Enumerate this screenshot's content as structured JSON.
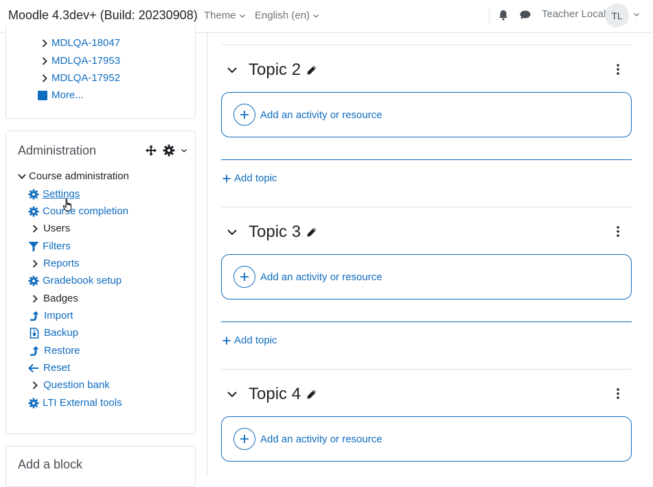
{
  "header": {
    "brand": "Moodle 4.3dev+ (Build: 20230908)",
    "theme_menu": "Theme",
    "language_menu": "English (en)",
    "user_name": "Teacher Local",
    "avatar_initials": "TL"
  },
  "sidebar": {
    "top_links": [
      "MDLQA-18047",
      "MDLQA-17953",
      "MDLQA-17952"
    ],
    "more_label": "More...",
    "admin_block": {
      "title": "Administration",
      "course_admin_label": "Course administration",
      "items": [
        {
          "label": "Settings",
          "icon": "gear-icon",
          "link": true
        },
        {
          "label": "Course completion",
          "icon": "gear-icon",
          "link": true
        },
        {
          "label": "Users",
          "icon": "chevron-right-icon",
          "link": false
        },
        {
          "label": "Filters",
          "icon": "filter-icon",
          "link": true
        },
        {
          "label": "Reports",
          "icon": "chevron-right-icon",
          "link": false
        },
        {
          "label": "Gradebook setup",
          "icon": "gear-icon",
          "link": true
        },
        {
          "label": "Badges",
          "icon": "chevron-right-icon",
          "link": false
        },
        {
          "label": "Import",
          "icon": "import-icon",
          "link": true
        },
        {
          "label": "Backup",
          "icon": "backup-icon",
          "link": true
        },
        {
          "label": "Restore",
          "icon": "restore-icon",
          "link": true
        },
        {
          "label": "Reset",
          "icon": "arrow-left-icon",
          "link": true
        },
        {
          "label": "Question bank",
          "icon": "chevron-right-icon",
          "link": true
        },
        {
          "label": "LTI External tools",
          "icon": "gear-icon",
          "link": true
        }
      ]
    },
    "add_block_title": "Add a block"
  },
  "main": {
    "topics": [
      {
        "title": "Topic 2",
        "add_label": "Add an activity or resource"
      },
      {
        "title": "Topic 3",
        "add_label": "Add an activity or resource"
      },
      {
        "title": "Topic 4",
        "add_label": "Add an activity or resource"
      }
    ],
    "add_topic_label": "Add topic"
  },
  "colors": {
    "link": "#0f6cbf",
    "text": "#1d2125",
    "muted": "#6a737b",
    "border": "#dee2e6"
  }
}
